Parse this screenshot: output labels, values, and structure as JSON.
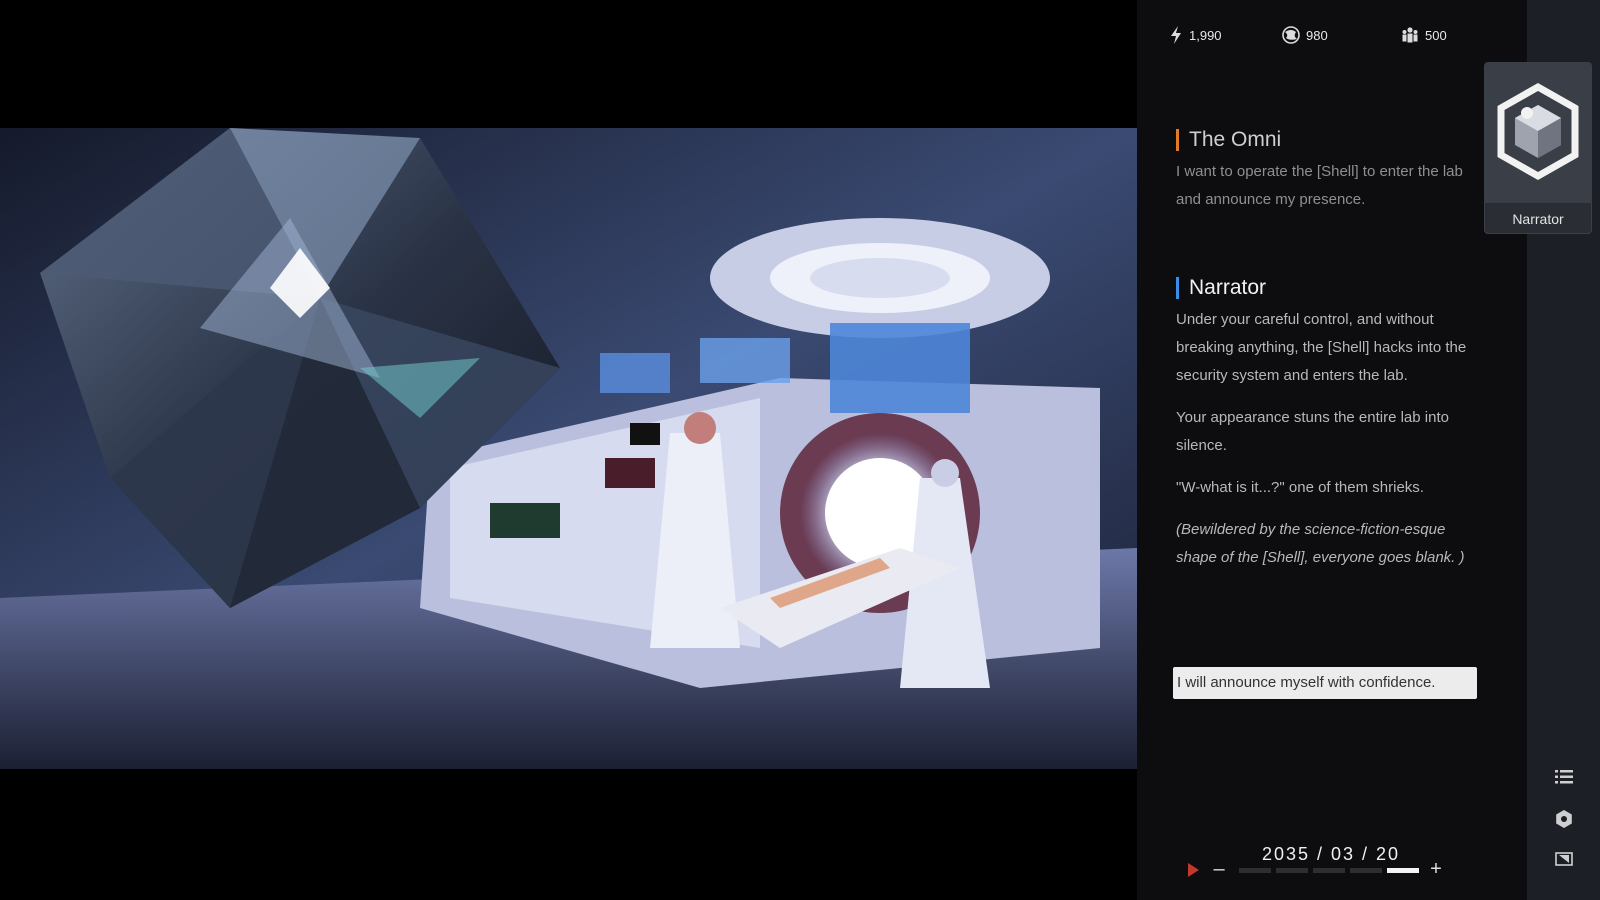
{
  "resources": {
    "energy": "1,990",
    "globe": "980",
    "people": "500",
    "energy_icon": "energy-bolt-icon",
    "globe_icon": "globe-icon",
    "people_icon": "people-icon"
  },
  "portrait": {
    "label": "Narrator",
    "icon": "hexagon-cube-emblem"
  },
  "dialogue": {
    "omni": {
      "speaker": "The Omni",
      "accent": "#e07b2a",
      "lines": [
        "I want to operate the [Shell] to enter the lab and announce my presence."
      ]
    },
    "narrator": {
      "speaker": "Narrator",
      "accent": "#3a8ee6",
      "lines": [
        "Under your careful control, and without breaking anything, the [Shell] hacks into the security system and enters the lab.",
        "Your appearance stuns the entire lab into silence.",
        "\"W-what is it...?\" one of them shrieks.",
        "(Bewildered by the science-fiction-esque shape of the [Shell], everyone goes blank. )"
      ]
    }
  },
  "choice": {
    "label": "I will announce myself with confidence."
  },
  "timeline": {
    "date": "2035 / 03 / 20",
    "segments": 5,
    "active_segment": 5,
    "play_icon": "play-icon",
    "minus_icon": "minus-icon",
    "plus_icon": "plus-icon"
  },
  "sidebar": {
    "icons": [
      "list-icon",
      "settings-icon",
      "skip-icon"
    ]
  },
  "colors": {
    "panel_bg": "#0d0d10",
    "sidebar_bg": "#1c1f26",
    "play_red": "#c0392b"
  }
}
